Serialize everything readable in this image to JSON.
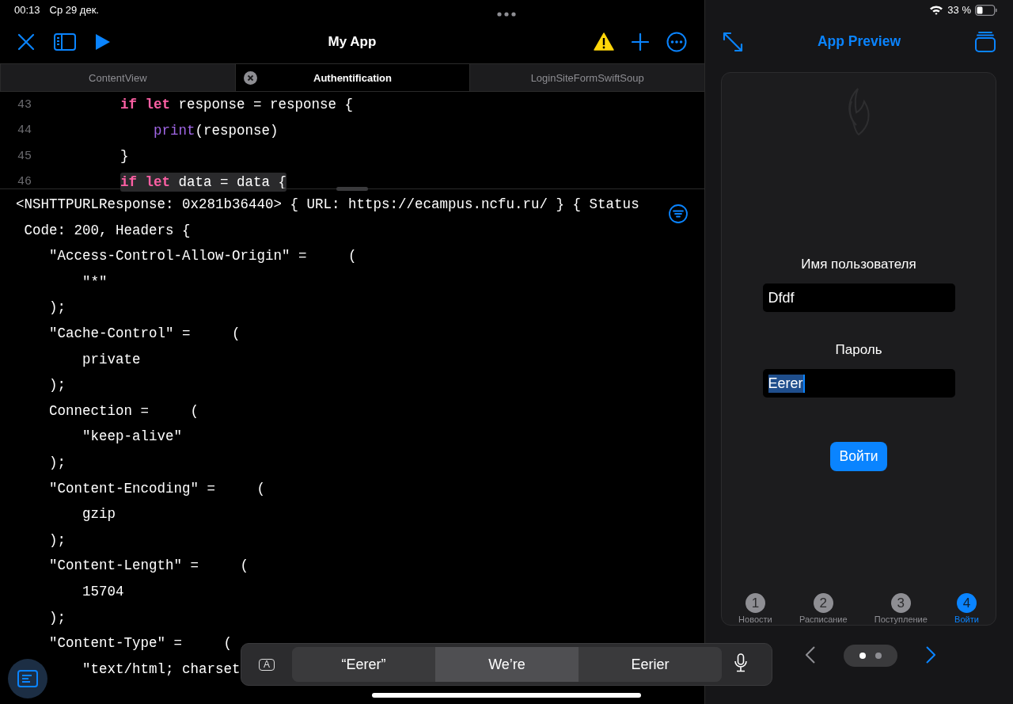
{
  "status_bar": {
    "time": "00:13",
    "date": "Ср 29 дек.",
    "battery": "33 %"
  },
  "toolbar": {
    "title": "My App"
  },
  "editor_tabs": [
    {
      "label": "ContentView",
      "selected": false
    },
    {
      "label": "Authentification",
      "selected": true
    },
    {
      "label": "LoginSiteFormSwiftSoup",
      "selected": false
    }
  ],
  "code_lines": [
    {
      "number": "43",
      "highlighted": false,
      "tokens": [
        {
          "kind": "keyword",
          "text": "if let"
        },
        {
          "kind": "plain",
          "text": " response = response {"
        }
      ]
    },
    {
      "number": "44",
      "highlighted": false,
      "tokens": [
        {
          "kind": "function",
          "text": "    print"
        },
        {
          "kind": "plain",
          "text": "(response)"
        }
      ]
    },
    {
      "number": "45",
      "highlighted": false,
      "tokens": [
        {
          "kind": "plain",
          "text": "}"
        }
      ]
    },
    {
      "number": "46",
      "highlighted": true,
      "tokens": [
        {
          "kind": "keyword",
          "text": "if let"
        },
        {
          "kind": "plain",
          "text": " data = data {"
        }
      ]
    }
  ],
  "console_lines": [
    "<NSHTTPURLResponse: 0x281b36440> { URL: https://ecampus.ncfu.ru/ } { Status",
    " Code: 200, Headers {",
    "    \"Access-Control-Allow-Origin\" =     (",
    "        \"*\"",
    "    );",
    "    \"Cache-Control\" =     (",
    "        private",
    "    );",
    "    Connection =     (",
    "        \"keep-alive\"",
    "    );",
    "    \"Content-Encoding\" =     (",
    "        gzip",
    "    );",
    "    \"Content-Length\" =     (",
    "        15704",
    "    );",
    "    \"Content-Type\" =     (",
    "        \"text/html; charset"
  ],
  "preview": {
    "title": "App Preview",
    "form": [
      {
        "label": "Имя пользователя",
        "value": "Dfdf",
        "text_selected": false
      },
      {
        "label": "Пароль",
        "value": "Eerer",
        "text_selected": true
      }
    ],
    "submit": "Войти",
    "tabs": [
      {
        "number": "1",
        "label": "Новости",
        "selected": false
      },
      {
        "number": "2",
        "label": "Расписание",
        "selected": false
      },
      {
        "number": "3",
        "label": "Поступление",
        "selected": false
      },
      {
        "number": "4",
        "label": "Войти",
        "selected": true
      }
    ],
    "pages": [
      {
        "selected": true
      },
      {
        "selected": false
      }
    ],
    "back_disabled": true,
    "forward_disabled": false
  },
  "suggestions": {
    "format_key": "A",
    "items": [
      {
        "text": "“Eerer”",
        "selected": false
      },
      {
        "text": "We’re",
        "selected": true
      },
      {
        "text": "Eerier",
        "selected": false
      }
    ]
  }
}
